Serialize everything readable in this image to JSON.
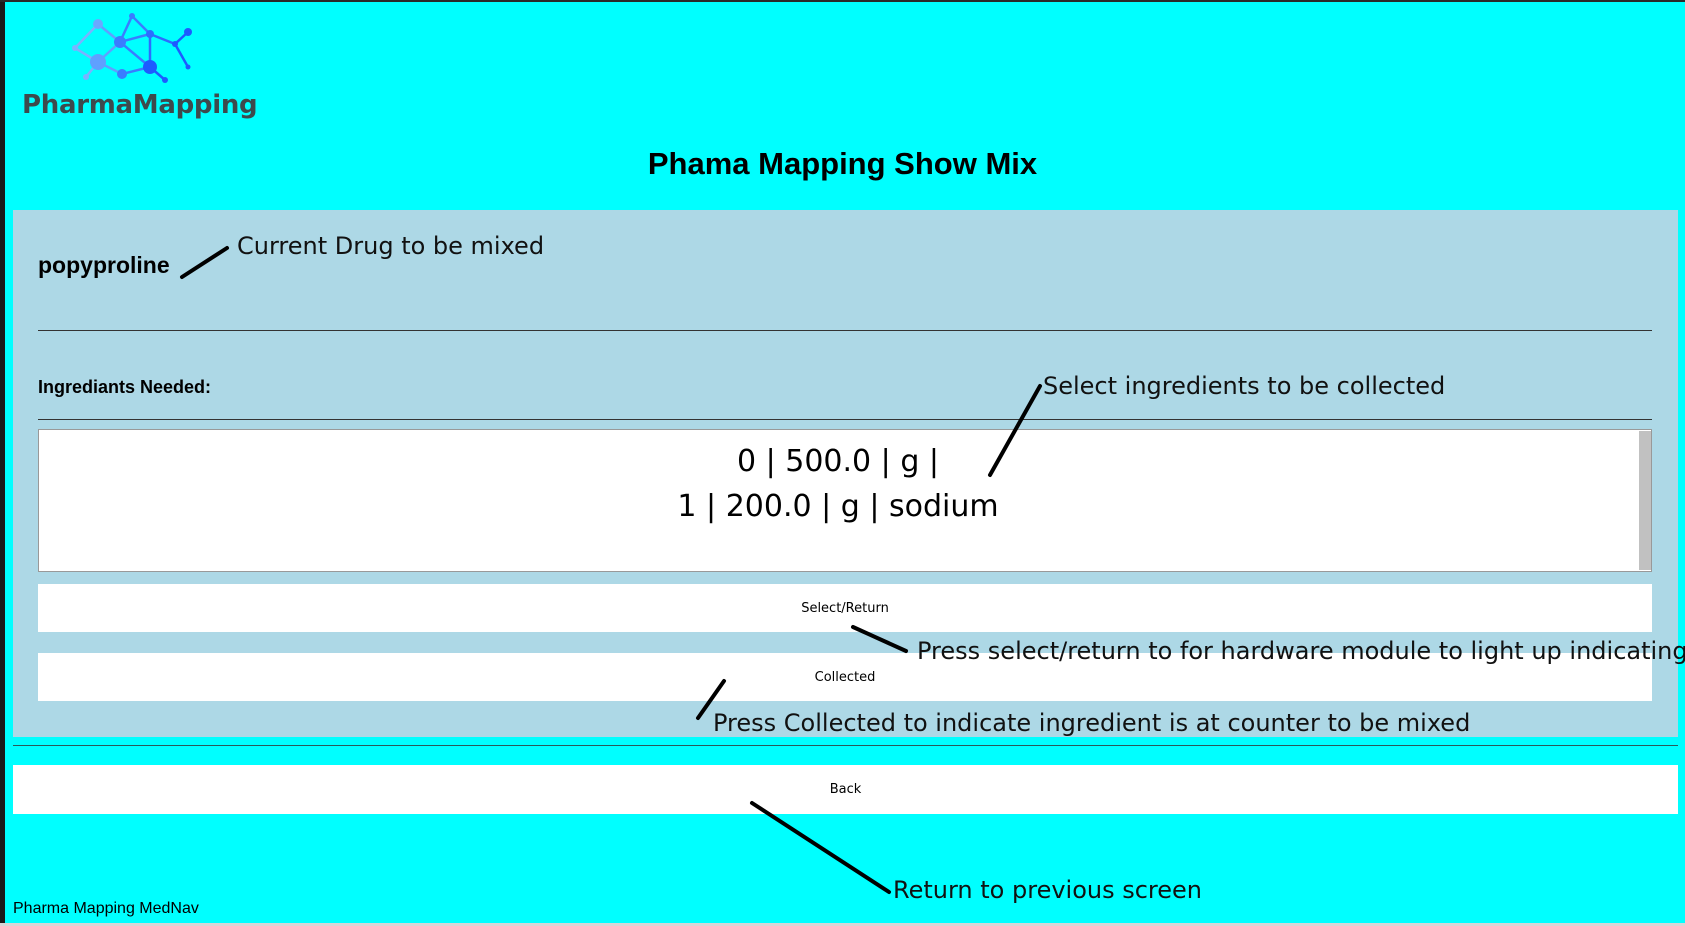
{
  "app": {
    "logo_text": "PharmaMapping",
    "title": "Phama Mapping Show Mix",
    "footer": "Pharma Mapping MedNav"
  },
  "drug": {
    "name": "popyproline"
  },
  "ingredients": {
    "label": "Ingrediants Needed:",
    "items": [
      "0 | 500.0 | g |",
      "1 | 200.0 | g | sodium"
    ]
  },
  "buttons": {
    "select_return": "Select/Return",
    "collected": "Collected",
    "back": "Back"
  },
  "annotations": {
    "drug": "Current Drug to be mixed",
    "select_ingredients": "Select ingredients to be collected",
    "select_return": "Press select/return to for hardware module to light up indicating loc",
    "collected": "Press Collected to indicate ingredient is at counter to be mixed",
    "back": "Return to previous screen"
  },
  "colors": {
    "background": "#00ffff",
    "panel": "#add8e6",
    "logo_accent": "#1e5bff"
  }
}
